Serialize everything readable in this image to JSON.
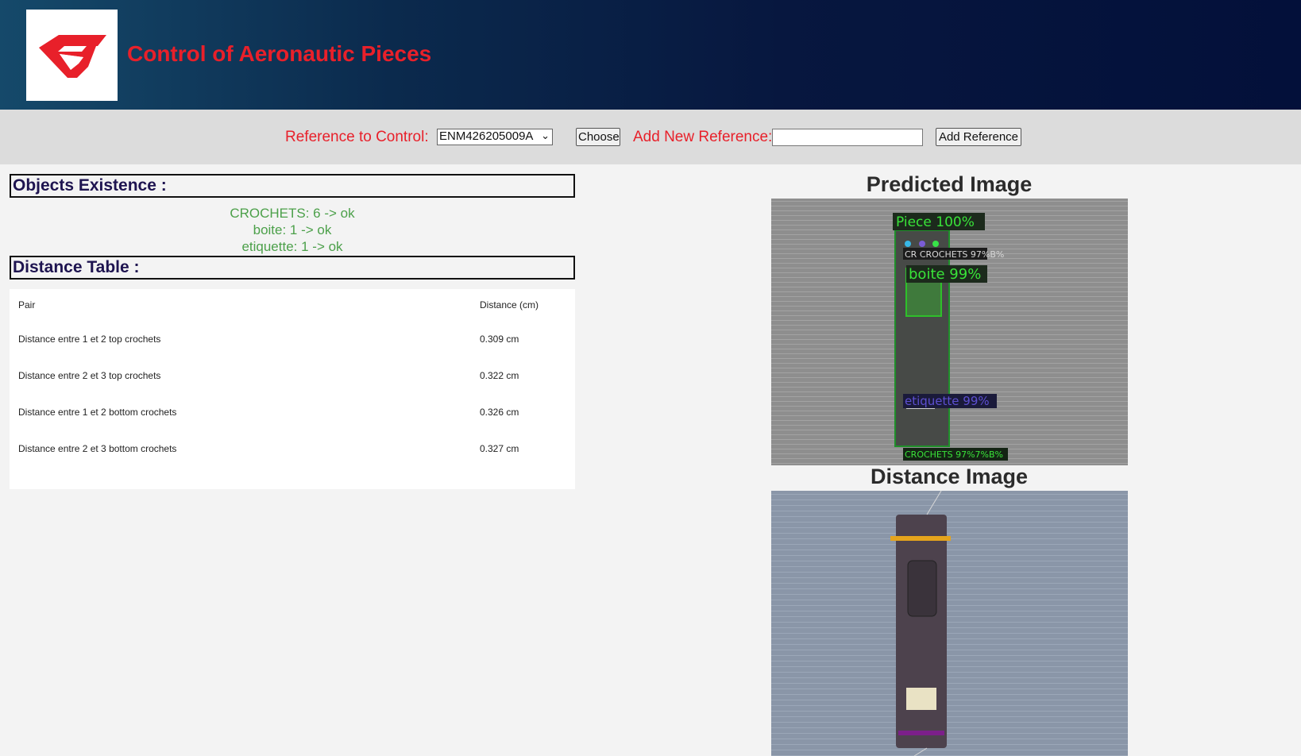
{
  "header": {
    "logo_icon": "red-stylized-G-logo",
    "title": "Control of Aeronautic Pieces",
    "brand_color": "#e8202a"
  },
  "controls": {
    "reference_label": "Reference to Control:",
    "reference_selected": "ENM426205009A",
    "choose_button": "Choose",
    "add_new_label": "Add New Reference:",
    "add_new_value": "",
    "add_reference_button": "Add Reference"
  },
  "existence": {
    "title": "Objects Existence :",
    "items": [
      "CROCHETS: 6 -> ok",
      "boite: 1 -> ok",
      "etiquette: 1 -> ok"
    ],
    "ok_color": "#4ca04a"
  },
  "distance": {
    "title": "Distance Table :",
    "columns": [
      "Pair",
      "Distance (cm)"
    ],
    "rows": [
      [
        "Distance entre 1 et 2 top crochets",
        "0.309 cm"
      ],
      [
        "Distance entre 2 et 3 top crochets",
        "0.322 cm"
      ],
      [
        "Distance entre 1 et 2 bottom crochets",
        "0.326 cm"
      ],
      [
        "Distance entre 2 et 3 bottom crochets",
        "0.327 cm"
      ]
    ]
  },
  "predicted": {
    "heading": "Predicted Image",
    "labels": {
      "piece": "Piece 100%",
      "crochets_top": "CR CROCHETS 97%B%",
      "boite": "boite 99%",
      "etiquette": "etiquette 99%",
      "crochets_bottom": "CROCHETS 97%7%B%"
    }
  },
  "distance_image": {
    "heading": "Distance Image"
  }
}
